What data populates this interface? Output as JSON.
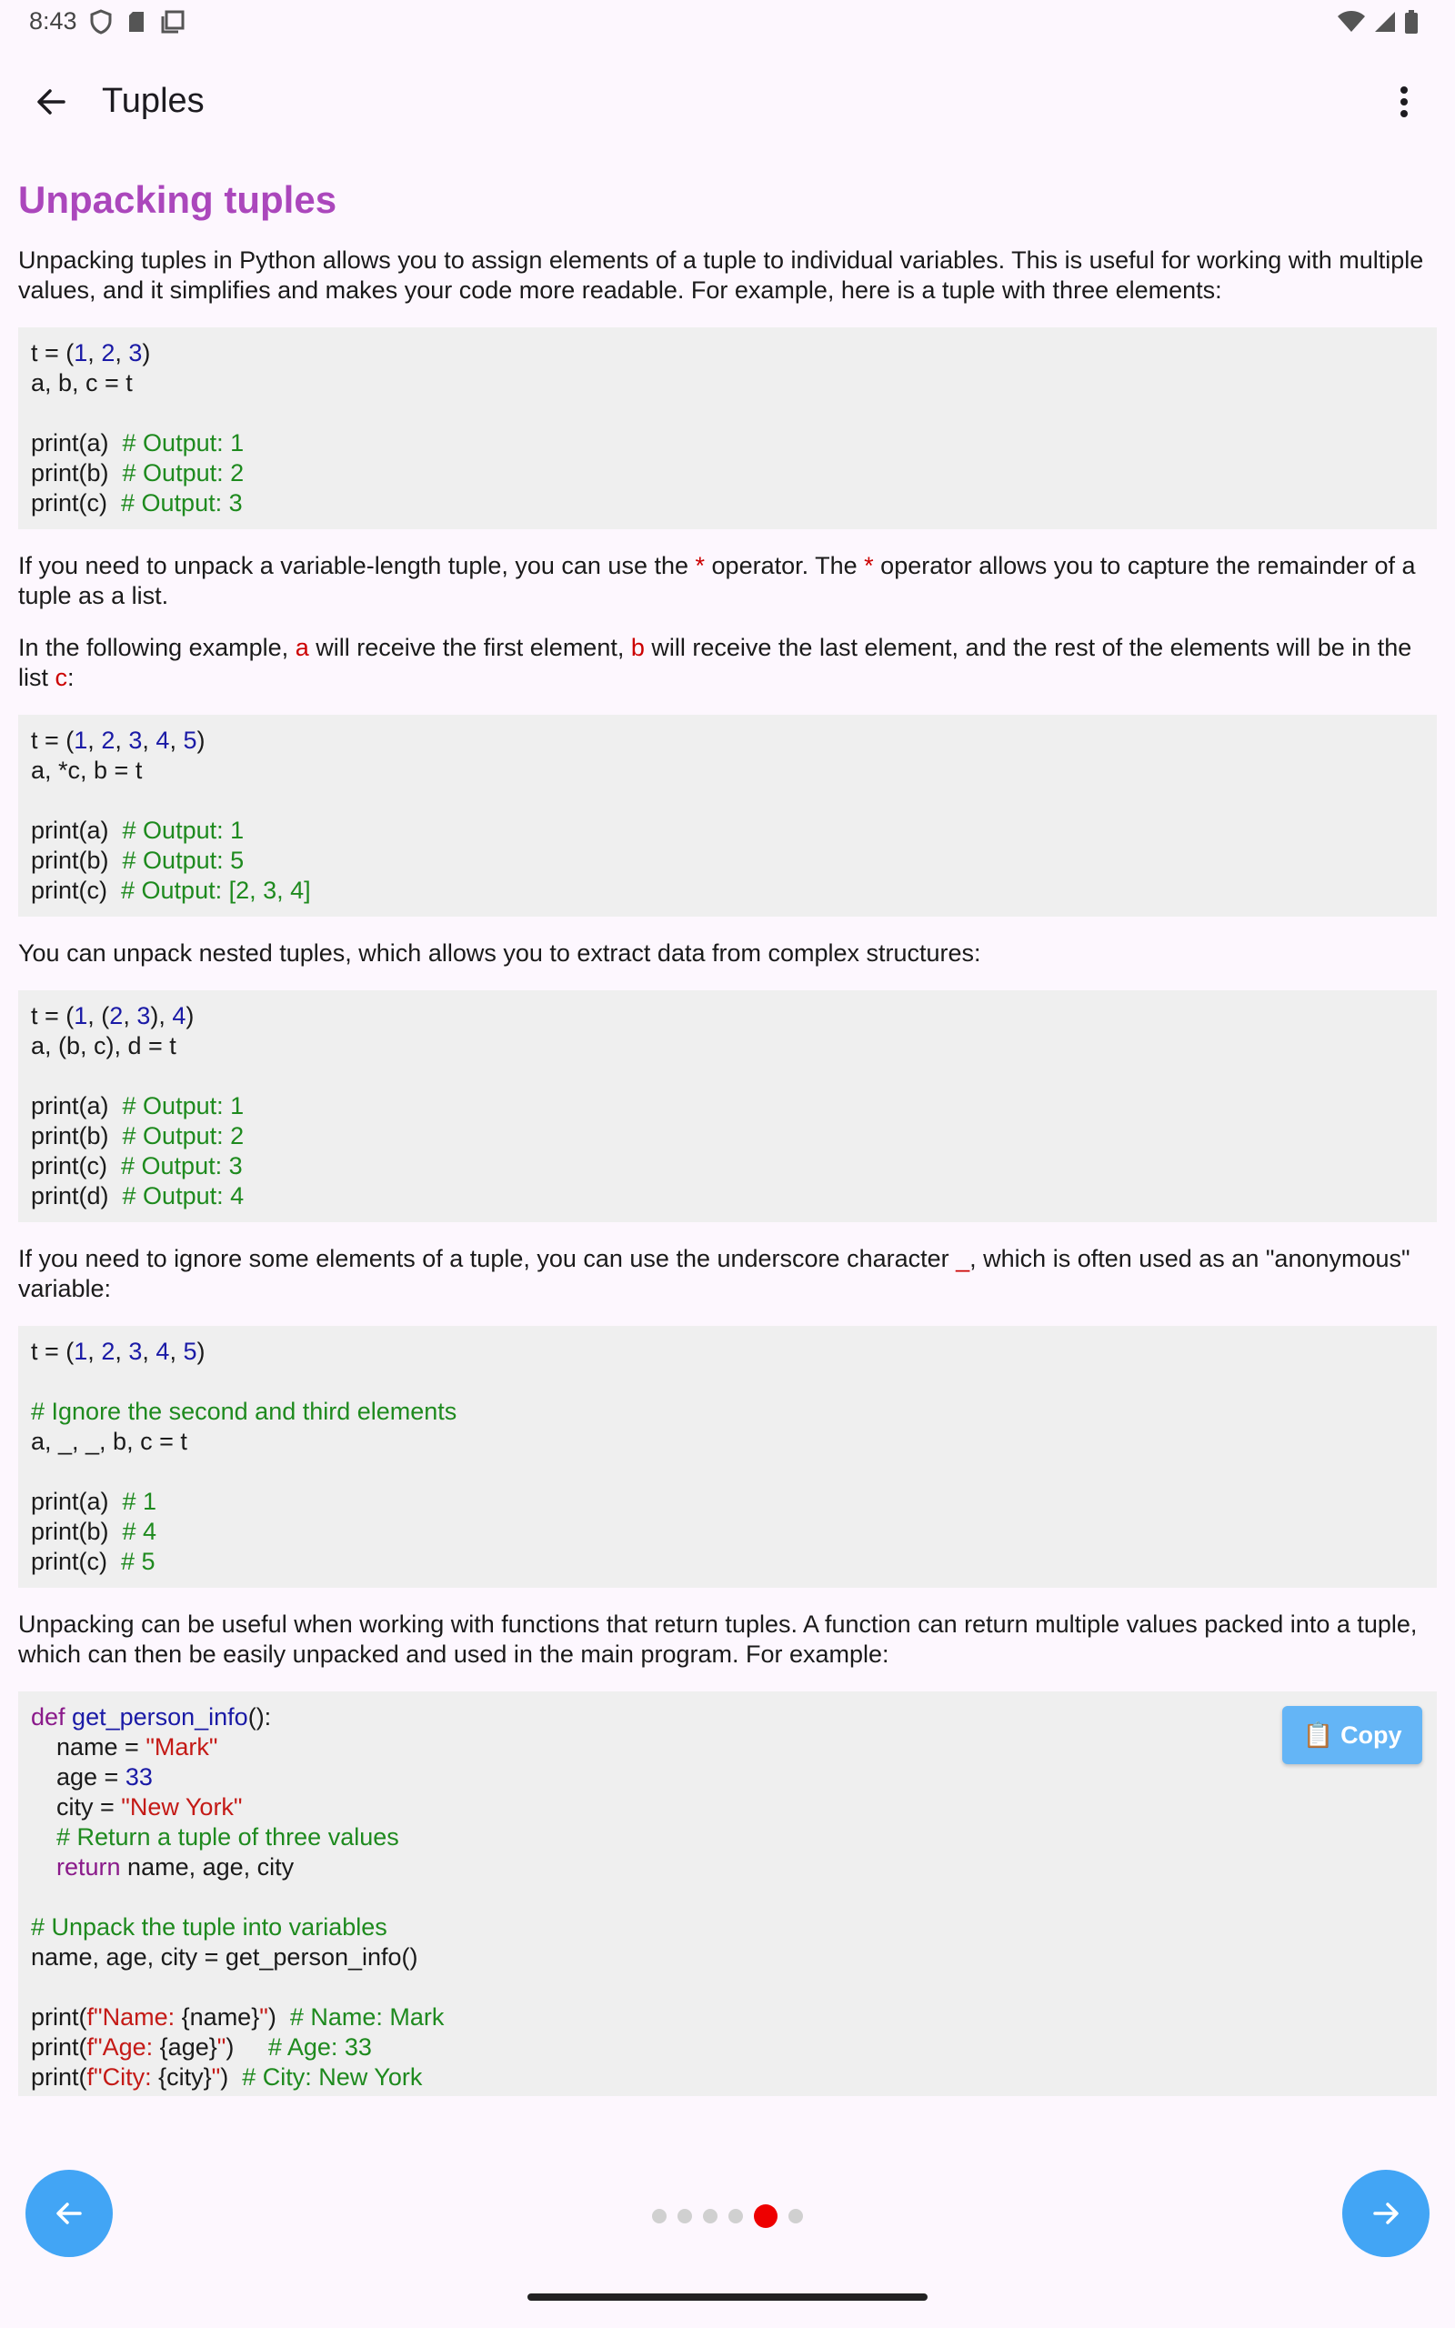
{
  "status_bar": {
    "time": "8:43"
  },
  "app_bar": {
    "title": "Tuples"
  },
  "content": {
    "heading": "Unpacking tuples",
    "p1": "Unpacking tuples in Python allows you to assign elements of a tuple to individual variables. This is useful for working with multiple values, and it simplifies and makes your code more readable. For example, here is a tuple with three elements:",
    "p2_a": "If you need to unpack a variable-length tuple, you can use the ",
    "p2_star1": "*",
    "p2_b": " operator. The ",
    "p2_star2": "*",
    "p2_c": " operator allows you to capture the remainder of a tuple as a list.",
    "p3_a": "In the following example, ",
    "p3_var_a": "a",
    "p3_b": " will receive the first element, ",
    "p3_var_b": "b",
    "p3_c": " will receive the last element, and the rest of the elements will be in the list ",
    "p3_var_c": "c",
    "p3_d": ":",
    "p4": "You can unpack nested tuples, which allows you to extract data from complex structures:",
    "p5_a": "If you need to ignore some elements of a tuple, you can use the underscore character ",
    "p5_us": "_",
    "p5_b": ", which is often used as an \"anonymous\" variable:",
    "p6": "Unpacking can be useful when working with functions that return tuples. A function can return multiple values packed into a tuple, which can then be easily unpacked and used in the main program. For example:",
    "code1": {
      "l1_t": "t = (",
      "l1_n1": "1",
      "l1_n2": "2",
      "l1_n3": "3",
      "l1_end": ")",
      "l2": "a, b, c = t",
      "l3_code": "print(a)  ",
      "l3_cm": "# Output: 1",
      "l4_code": "print(b)  ",
      "l4_cm": "# Output: 2",
      "l5_code": "print(c)  ",
      "l5_cm": "# Output: 3"
    },
    "code2": {
      "l1_t": "t = (",
      "l1_n1": "1",
      "l1_n2": "2",
      "l1_n3": "3",
      "l1_n4": "4",
      "l1_n5": "5",
      "l1_end": ")",
      "l2": "a, *c, b = t",
      "l3_code": "print(a)  ",
      "l3_cm": "# Output: 1",
      "l4_code": "print(b)  ",
      "l4_cm": "# Output: 5",
      "l5_code": "print(c)  ",
      "l5_cm": "# Output: [2, 3, 4]"
    },
    "code3": {
      "l1_t": "t = (",
      "l1_n1": "1",
      "l1_open": ", (",
      "l1_n2": "2",
      "l1_n3": "3",
      "l1_close": "), ",
      "l1_n4": "4",
      "l1_end": ")",
      "l2": "a, (b, c), d = t",
      "l3_code": "print(a)  ",
      "l3_cm": "# Output: 1",
      "l4_code": "print(b)  ",
      "l4_cm": "# Output: 2",
      "l5_code": "print(c)  ",
      "l5_cm": "# Output: 3",
      "l6_code": "print(d)  ",
      "l6_cm": "# Output: 4"
    },
    "code4": {
      "l1_t": "t = (",
      "l1_n1": "1",
      "l1_n2": "2",
      "l1_n3": "3",
      "l1_n4": "4",
      "l1_n5": "5",
      "l1_end": ")",
      "l2_cm": "# Ignore the second and third elements",
      "l3": "a, _, _, b, c = t",
      "l4_code": "print(a)  ",
      "l4_cm": "# 1",
      "l5_code": "print(b)  ",
      "l5_cm": "# 4",
      "l6_code": "print(c)  ",
      "l6_cm": "# 5"
    },
    "code5": {
      "l1_kw": "def",
      "l1_fn": " get_person_info",
      "l1_end": "():",
      "l2_code": "name = ",
      "l2_str": "\"Mark\"",
      "l3_code": "age = ",
      "l3_num": "33",
      "l4_code": "city = ",
      "l4_str": "\"New York\"",
      "l5_cm": "# Return a tuple of three values",
      "l6_kw": "return",
      "l6_code": " name, age, city",
      "l7_cm": "# Unpack the tuple into variables",
      "l8": "name, age, city = get_person_info()",
      "l9_a": "print(",
      "l9_str": "f\"Name: ",
      "l9_b": "{name}",
      "l9_str2": "\"",
      "l9_c": ")  ",
      "l9_cm": "# Name: Mark",
      "l10_a": "print(",
      "l10_str": "f\"Age: ",
      "l10_b": "{age}",
      "l10_str2": "\"",
      "l10_c": ")     ",
      "l10_cm": "# Age: 33",
      "l11_a": "print(",
      "l11_str": "f\"City: ",
      "l11_b": "{city}",
      "l11_str2": "\"",
      "l11_c": ")  ",
      "l11_cm": "# City: New York",
      "copy_label": "Copy",
      "copy_icon": "📋"
    }
  },
  "pager": {
    "total": 6,
    "active": 5
  },
  "colors": {
    "heading": "#AB47BC",
    "fab": "#42A5F5",
    "active_dot": "#EE0000",
    "copy_button": "#64B5F6"
  }
}
